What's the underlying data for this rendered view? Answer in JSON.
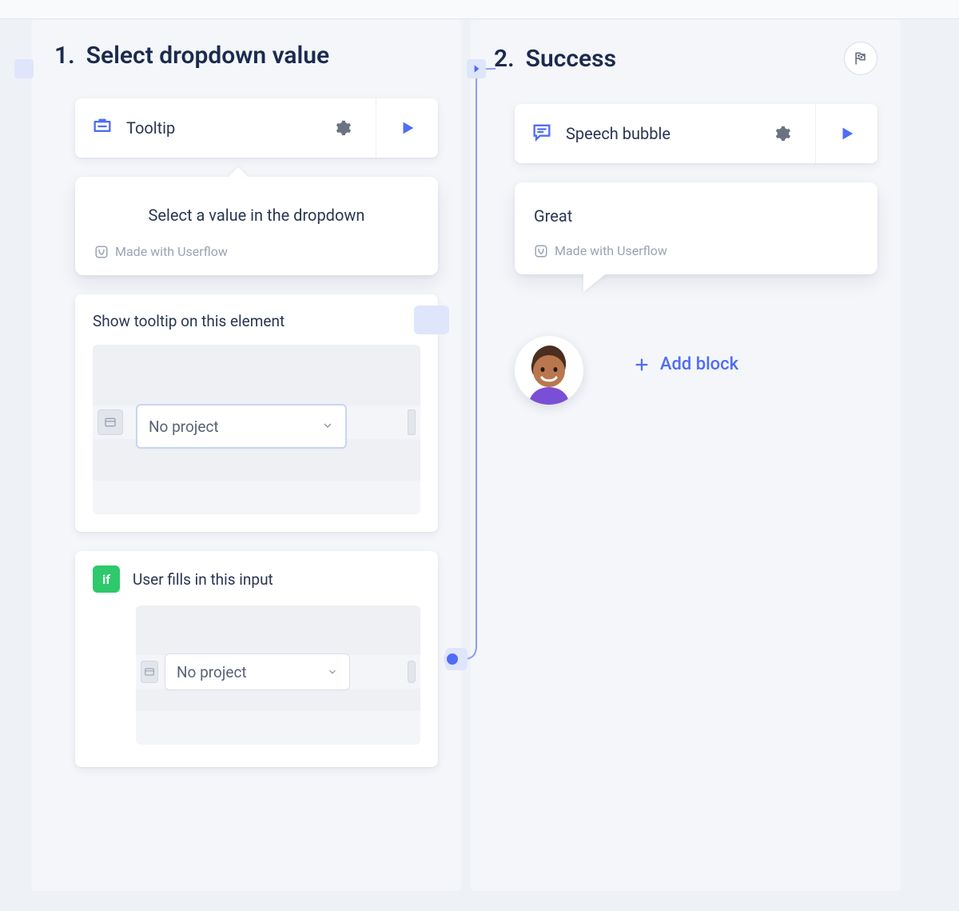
{
  "steps": [
    {
      "number": "1.",
      "title": "Select dropdown value",
      "block": {
        "type_label": "Tooltip"
      },
      "tooltip_preview": {
        "text": "Select a value in the dropdown",
        "attribution": "Made with Userflow"
      },
      "element_section": {
        "title": "Show tooltip on this element",
        "dropdown_value": "No project"
      },
      "trigger": {
        "badge": "if",
        "title": "User fills in this input",
        "dropdown_value": "No project"
      }
    },
    {
      "number": "2.",
      "title": "Success",
      "block": {
        "type_label": "Speech bubble"
      },
      "speech_preview": {
        "text": "Great",
        "attribution": "Made with Userflow"
      },
      "add_block_label": "Add block"
    }
  ],
  "colors": {
    "primary": "#4f6df5",
    "text": "#1b2a4e",
    "muted": "#9aa3b5",
    "success": "#2dc96b"
  }
}
